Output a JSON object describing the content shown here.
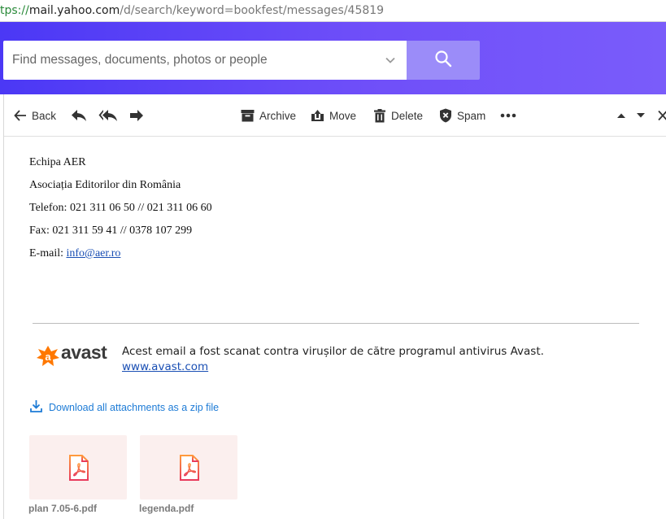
{
  "browser": {
    "url_scheme": "tps://",
    "url_host": "mail.yahoo.com",
    "url_path": "/d/search/keyword=bookfest/messages/45819"
  },
  "search": {
    "placeholder": "Find messages, documents, photos or people"
  },
  "toolbar": {
    "back_label": "Back",
    "archive_label": "Archive",
    "move_label": "Move",
    "delete_label": "Delete",
    "spam_label": "Spam"
  },
  "message": {
    "signature_name": "Echipa AER",
    "organization": "Asociația Editorilor din România",
    "phone": "Telefon: 021 311 06 50 // 021 311 06 60",
    "fax": "Fax: 021 311 59 41 // 0378 107 299",
    "email_prefix": "E-mail: ",
    "email_link": "info@aer.ro"
  },
  "avast": {
    "logo_text": "avast",
    "scan_notice": "Acest email a fost scanat contra virușilor de către programul antivirus Avast.",
    "link": "www.avast.com"
  },
  "attachments": {
    "download_all_label": "Download all attachments as a zip file",
    "files": [
      {
        "name": "plan 7.05-6.pdf"
      },
      {
        "name": "legenda.pdf"
      }
    ]
  },
  "colors": {
    "header_start": "#4b38f5",
    "header_end": "#7a5cfa",
    "search_button": "#9b8cf9",
    "link": "#1a4fb4",
    "download_link": "#1d7bd6",
    "avast_orange": "#ff7800",
    "pdf_red": "#e83a5c",
    "attachment_bg": "#fbefee"
  }
}
